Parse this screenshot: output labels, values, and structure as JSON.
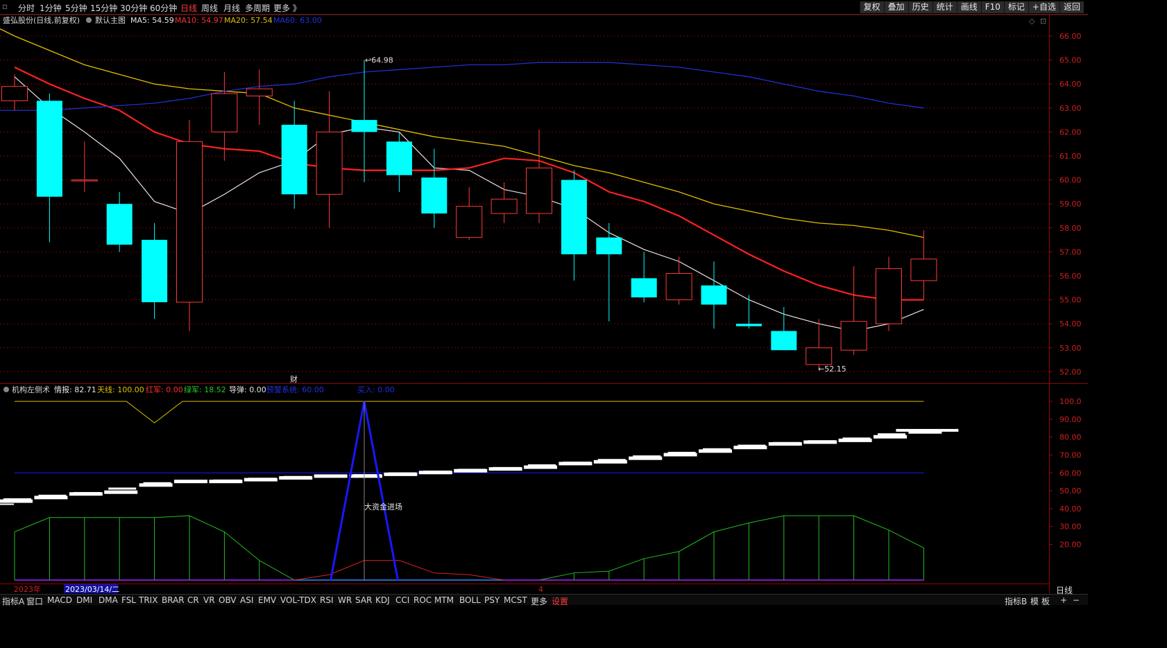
{
  "topbar": {
    "periods": [
      "分时",
      "1分钟",
      "5分钟",
      "15分钟",
      "30分钟",
      "60分钟",
      "日线",
      "周线",
      "月线",
      "多周期",
      "更多 》"
    ],
    "selected_period": "日线",
    "buttons": [
      "复权",
      "叠加",
      "历史",
      "统计",
      "画线",
      "F10",
      "标记",
      "+自选",
      "返回"
    ]
  },
  "main_legend": {
    "stock": "盛弘股份(日线,前复权)",
    "main_chart": "默认主图",
    "ma5": "MA5: 54.59",
    "ma10": "MA10: 54.97",
    "ma20": "MA20: 57.54",
    "ma60": "MA60: 63.00"
  },
  "indicator_legend": {
    "name": "机构左侧术",
    "qingbao": "情报: 82.71",
    "tianxian": "天线: 100.00",
    "hongjun": "红军: 0.00",
    "lvjun": "绿军: 18.52",
    "daodan": "导弹: 0.00",
    "yujing": "预警系统: 60.00",
    "mairu": "买入: 0.00"
  },
  "annotations": {
    "high_label": "64.98",
    "low_label": "52.15",
    "cai_marker": "财",
    "big_money": "大资金进场",
    "year_label": "2023年",
    "date_label": "2023/03/14/二",
    "month_label": "4"
  },
  "colors": {
    "up": "#ff3b3b",
    "down": "#00ffff",
    "ma5": "#e6e6e6",
    "ma10": "#ff2020",
    "ma20": "#e0c000",
    "ma60": "#2030d0",
    "green": "#20c020",
    "blue_line": "#1818ff",
    "grid": "#7a0000"
  },
  "main_yaxis": [
    "66.00",
    "65.00",
    "64.00",
    "63.00",
    "62.00",
    "61.00",
    "60.00",
    "59.00",
    "58.00",
    "57.00",
    "56.00",
    "55.00",
    "54.00",
    "53.00",
    "52.00"
  ],
  "ind_yaxis": [
    "100.0",
    "90.00",
    "80.00",
    "70.00",
    "60.00",
    "50.00",
    "40.00",
    "30.00",
    "20.00"
  ],
  "chart_data": {
    "type": "candlestick",
    "title": "盛弘股份(日线,前复权)",
    "ylim": [
      51.7,
      66.3
    ],
    "candles": [
      {
        "o": 63.3,
        "c": 63.9,
        "h": 64.4,
        "l": 62.9
      },
      {
        "o": 63.3,
        "c": 59.3,
        "h": 63.6,
        "l": 57.4
      },
      {
        "o": 60.0,
        "c": 60.0,
        "h": 61.6,
        "l": 59.5
      },
      {
        "o": 59.0,
        "c": 57.3,
        "h": 59.5,
        "l": 57.0
      },
      {
        "o": 57.5,
        "c": 54.9,
        "h": 58.2,
        "l": 54.2
      },
      {
        "o": 54.9,
        "c": 61.6,
        "h": 62.5,
        "l": 53.7
      },
      {
        "o": 62.0,
        "c": 63.6,
        "h": 64.5,
        "l": 60.8
      },
      {
        "o": 63.5,
        "c": 63.8,
        "h": 64.6,
        "l": 62.3
      },
      {
        "o": 62.3,
        "c": 59.4,
        "h": 63.3,
        "l": 58.8
      },
      {
        "o": 59.4,
        "c": 62.0,
        "h": 63.7,
        "l": 58.0
      },
      {
        "o": 62.5,
        "c": 62.0,
        "h": 65.0,
        "l": 59.9
      },
      {
        "o": 61.6,
        "c": 60.2,
        "h": 62.0,
        "l": 59.5
      },
      {
        "o": 60.1,
        "c": 58.6,
        "h": 61.3,
        "l": 58.0
      },
      {
        "o": 57.6,
        "c": 58.9,
        "h": 59.7,
        "l": 57.5
      },
      {
        "o": 58.6,
        "c": 59.2,
        "h": 59.9,
        "l": 58.2
      },
      {
        "o": 58.6,
        "c": 60.5,
        "h": 62.1,
        "l": 58.2
      },
      {
        "o": 60.0,
        "c": 56.9,
        "h": 60.4,
        "l": 55.8
      },
      {
        "o": 57.6,
        "c": 56.9,
        "h": 58.2,
        "l": 54.1
      },
      {
        "o": 55.9,
        "c": 55.1,
        "h": 57.0,
        "l": 54.9
      },
      {
        "o": 55.0,
        "c": 56.1,
        "h": 56.8,
        "l": 54.8
      },
      {
        "o": 55.6,
        "c": 54.8,
        "h": 56.6,
        "l": 53.8
      },
      {
        "o": 54.0,
        "c": 53.9,
        "h": 55.2,
        "l": 53.8
      },
      {
        "o": 53.7,
        "c": 52.9,
        "h": 54.7,
        "l": 52.9
      },
      {
        "o": 52.3,
        "c": 53.0,
        "h": 54.2,
        "l": 52.15
      },
      {
        "o": 52.9,
        "c": 54.1,
        "h": 56.4,
        "l": 52.7
      },
      {
        "o": 54.0,
        "c": 56.3,
        "h": 56.8,
        "l": 53.7
      },
      {
        "o": 55.8,
        "c": 56.7,
        "h": 57.9,
        "l": 55.0
      }
    ],
    "series": [
      {
        "name": "MA5",
        "values": [
          64.3,
          63.0,
          62.0,
          60.9,
          59.1,
          58.6,
          59.4,
          60.3,
          60.8,
          61.9,
          62.2,
          62.0,
          60.5,
          60.4,
          59.6,
          59.3,
          58.8,
          57.8,
          57.1,
          56.6,
          55.8,
          55.0,
          54.4,
          54.0,
          53.7,
          54.0,
          54.6
        ]
      },
      {
        "name": "MA10",
        "values": [
          64.7,
          64.0,
          63.4,
          62.9,
          62.0,
          61.5,
          61.3,
          61.2,
          60.7,
          60.5,
          60.4,
          60.4,
          60.4,
          60.5,
          60.9,
          60.8,
          60.3,
          59.5,
          59.1,
          58.5,
          57.7,
          56.9,
          56.2,
          55.6,
          55.2,
          55.0,
          55.0
        ]
      },
      {
        "name": "MA20",
        "values": [
          66.0,
          65.4,
          64.8,
          64.4,
          64.0,
          63.8,
          63.7,
          63.6,
          63.0,
          62.7,
          62.4,
          62.1,
          61.8,
          61.6,
          61.4,
          61.0,
          60.6,
          60.3,
          59.9,
          59.5,
          59.0,
          58.7,
          58.4,
          58.2,
          58.1,
          57.9,
          57.6
        ]
      },
      {
        "name": "MA60",
        "values": [
          62.9,
          62.9,
          63.0,
          63.1,
          63.2,
          63.4,
          63.7,
          63.9,
          64.0,
          64.3,
          64.5,
          64.6,
          64.7,
          64.8,
          64.8,
          64.9,
          64.9,
          64.9,
          64.8,
          64.7,
          64.5,
          64.3,
          64.0,
          63.7,
          63.5,
          63.2,
          63.0
        ]
      }
    ],
    "indicator": {
      "ylim": [
        0,
        102
      ],
      "tianxian": [
        100,
        100,
        100,
        100,
        100,
        100,
        100,
        100,
        100,
        100,
        100,
        100,
        100,
        100,
        100,
        100,
        100,
        100,
        100,
        100,
        100,
        100,
        100,
        100,
        100,
        100,
        100
      ],
      "yujing": 60,
      "green": [
        27,
        35,
        35,
        35,
        35,
        36,
        27,
        11,
        0,
        0,
        0,
        0,
        0,
        0,
        0,
        0,
        4,
        5,
        12,
        16,
        27,
        32,
        36,
        36,
        36,
        28,
        18
      ],
      "red": [
        0,
        0,
        0,
        0,
        0,
        0,
        0,
        0,
        0,
        3,
        11,
        11,
        4,
        3,
        0,
        0,
        0,
        0,
        0,
        0,
        0,
        0,
        0,
        0,
        0,
        0,
        0
      ],
      "qingbao": [
        44,
        46,
        48,
        49,
        53,
        55,
        55,
        56,
        57,
        58,
        58,
        59,
        60,
        61,
        62,
        63,
        65,
        66,
        68,
        70,
        72,
        74,
        76,
        77,
        78,
        80,
        82.71
      ]
    }
  },
  "bottombar": {
    "items": [
      "指标A",
      "窗口",
      "MACD",
      "DMI",
      "DMA",
      "FSL",
      "TRIX",
      "BRAR",
      "CR",
      "VR",
      "OBV",
      "ASI",
      "EMV",
      "VOL-TDX",
      "RSI",
      "WR",
      "SAR",
      "KDJ",
      "CCI",
      "ROC",
      "MTM",
      "BOLL",
      "PSY",
      "MCST",
      "更多",
      "设置"
    ],
    "highlight": "设置",
    "right_items": [
      "指标B",
      "模",
      "板",
      "+",
      "−"
    ],
    "day_tab": "日线"
  }
}
